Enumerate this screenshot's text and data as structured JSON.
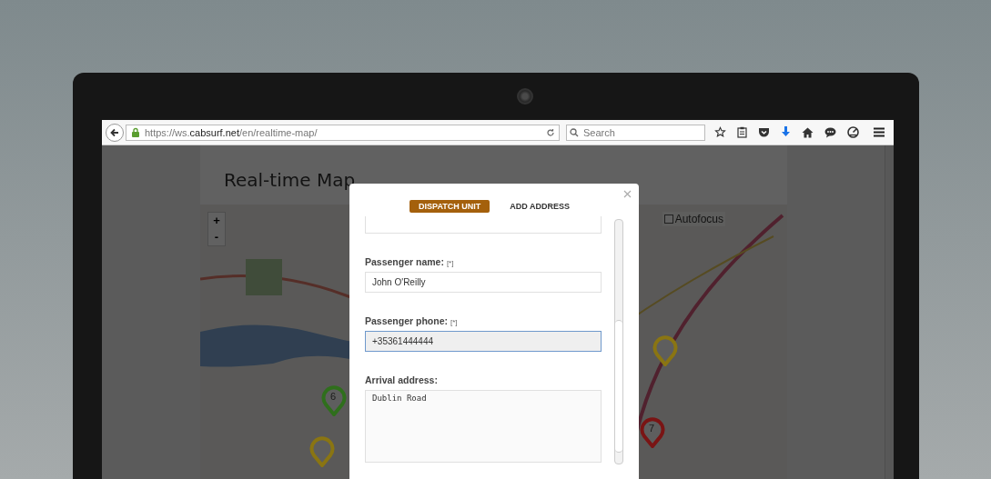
{
  "browser": {
    "url": "https://ws.**cabsurf.net**/en/realtime-map/",
    "search": {
      "placeholder": "Search"
    }
  },
  "page": {
    "title": "Real-time Map",
    "zoom_controls": [
      "+",
      "-"
    ],
    "autofocus": {
      "label": "Autofocus",
      "checked": false
    },
    "markers": [
      {
        "label": "6",
        "color": "#2f6f1c"
      },
      {
        "color": "#8a7512"
      },
      {
        "color": "#8a7512"
      },
      {
        "label": "7",
        "color": "#7a1414"
      }
    ]
  },
  "modal": {
    "tabs": [
      {
        "label": "DISPATCH UNIT",
        "selected": true
      },
      {
        "label": "ADD ADDRESS",
        "selected": false
      }
    ],
    "fields": [
      {
        "kind": "input",
        "focused": false
      },
      {
        "kind": "input",
        "label": "Passenger name:",
        "required_mark": "[*]",
        "value": "John O'Reilly",
        "focused": false
      },
      {
        "kind": "input",
        "label": "Passenger phone:",
        "required_mark": "[*]",
        "value": "+35361444444",
        "focused": true
      },
      {
        "kind": "textarea",
        "label": "Arrival address:",
        "value": "Dublin Road",
        "focused": false
      }
    ]
  }
}
